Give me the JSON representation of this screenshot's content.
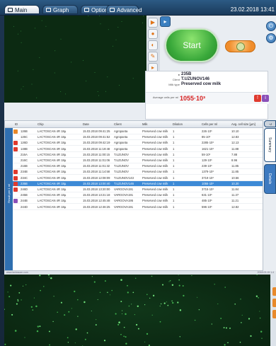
{
  "tabs": [
    {
      "label": "Main",
      "active": true
    },
    {
      "label": "Graph",
      "active": false
    },
    {
      "label": "Options",
      "active": false
    },
    {
      "label": "Advanced",
      "active": false
    }
  ],
  "datetime": "23.02.2018 13:41 ",
  "start_label": "Start",
  "sample": {
    "id": "235B",
    "client_label": "Client",
    "client": "T.UZUNOV146",
    "type_label": "Milk type",
    "type": "Preserved cow milk",
    "avg_label": "Average cells per ml",
    "avg_value": "1055·10³"
  },
  "table": {
    "headers": [
      "ID",
      "Chip",
      "Date",
      "Client",
      "Milk",
      "Dilution",
      "Cells per ml",
      "Avg. cell size [µm]"
    ],
    "rows": [
      {
        "id": "126B",
        "chip": "LACTOSCAN 4R 18µ",
        "date": "15.03.2018 09:41:25",
        "client": "Agropanta",
        "milk": "Preserved cow milk",
        "dil": "1",
        "cells": "226·10³",
        "size": "10.10",
        "badge": "#e8892b"
      },
      {
        "id": "126C",
        "chip": "LACTOSCAN 4R 18µ",
        "date": "15.03.2018 09:41:52",
        "client": "Agropanta",
        "milk": "Preserved cow milk",
        "dil": "1",
        "cells": "85·10³",
        "size": "12.83",
        "badge": ""
      },
      {
        "id": "126D",
        "chip": "LACTOSCAN 4R 18µ",
        "date": "15.03.2018 09:42:19",
        "client": "Agropanta",
        "milk": "Preserved cow milk",
        "dil": "1",
        "cells": "2285·10³",
        "size": "12.13",
        "badge": "#e03a2e"
      },
      {
        "id": "148B",
        "chip": "LACTOSCAN 4R 18µ",
        "date": "15.03.2018 11:19:48",
        "client": "Agropanta",
        "milk": "Preserved cow milk",
        "dil": "1",
        "cells": "1621·10³",
        "size": "11.88",
        "badge": "#e03a2e"
      },
      {
        "id": "216A",
        "chip": "LACTOSCAN 4R 18µ",
        "date": "15.03.2018 11:00:15",
        "client": "T.UZUNOV",
        "milk": "Preserved cow milk",
        "dil": "1",
        "cells": "59·10³",
        "size": "7.88",
        "badge": ""
      },
      {
        "id": "216C",
        "chip": "LACTOSCAN 4R 18µ",
        "date": "15.03.2018 11:01:06",
        "client": "T.UZUNOV",
        "milk": "Preserved cow milk",
        "dil": "1",
        "cells": "129·10³",
        "size": "8.96",
        "badge": ""
      },
      {
        "id": "216B",
        "chip": "LACTOSCAN 4R 18µ",
        "date": "15.03.2018 11:01:32",
        "client": "T.UZUNOV",
        "milk": "Preserved cow milk",
        "dil": "1",
        "cells": "239·10³",
        "size": "11.85",
        "badge": ""
      },
      {
        "id": "234B",
        "chip": "LACTOSCAN 4R 18µ",
        "date": "15.03.2018 11:14:58",
        "client": "T.UZUNOV",
        "milk": "Preserved cow milk",
        "dil": "1",
        "cells": "1379·10³",
        "size": "11.85",
        "badge": "#e03a2e"
      },
      {
        "id": "234C",
        "chip": "LACTOSCAN 4R 18µ",
        "date": "15.03.2018 12:08:09",
        "client": "T.UZUNOV143",
        "milk": "Preserved cow milk",
        "dil": "1",
        "cells": "3719·10³",
        "size": "10.56",
        "badge": "#e03a2e"
      },
      {
        "id": "235B",
        "chip": "LACTOSCAN 4R 18µ",
        "date": "15.03.2018 13:00:40",
        "client": "T.UZUNOV146",
        "milk": "Preserved cow milk",
        "dil": "1",
        "cells": "1055·10³",
        "size": "10.20",
        "badge": "#e03a2e",
        "selected": true
      },
      {
        "id": "246D",
        "chip": "LACTOSCAN 4R 18µ",
        "date": "15.03.2018 13:20:00",
        "client": "VARGOVA191",
        "milk": "Preserved cow milk",
        "dil": "1",
        "cells": "3715·10³",
        "size": "11.84",
        "badge": "#e03a2e"
      },
      {
        "id": "245B",
        "chip": "LACTOSCAN 4R 18µ",
        "date": "15.03.2018 13:21:18",
        "client": "VARGOVA191",
        "milk": "Preserved cow milk",
        "dil": "1",
        "cells": "631·10³",
        "size": "11.37",
        "badge": ""
      },
      {
        "id": "244B",
        "chip": "LACTOSCAN 4R 18µ",
        "date": "15.03.2018 12:45:48",
        "client": "VARGOVA195",
        "milk": "Preserved cow milk",
        "dil": "1",
        "cells": "485·10³",
        "size": "11.21",
        "badge": "#8a4fb8"
      },
      {
        "id": "244D",
        "chip": "LACTOSCAN 4R 18µ",
        "date": "15.03.2018 12:46:25",
        "client": "VARGOVA191",
        "milk": "Preserved cow milk",
        "dil": "1",
        "cells": "596·10³",
        "size": "12.82",
        "badge": ""
      }
    ],
    "gutter_label": "Result per 1 ml"
  },
  "side_tabs": {
    "help": "?",
    "summary": "Summary",
    "details": "Details"
  },
  "footer": {
    "left": "www.lactoscan.com",
    "right": "2018.03.15 1.4"
  }
}
